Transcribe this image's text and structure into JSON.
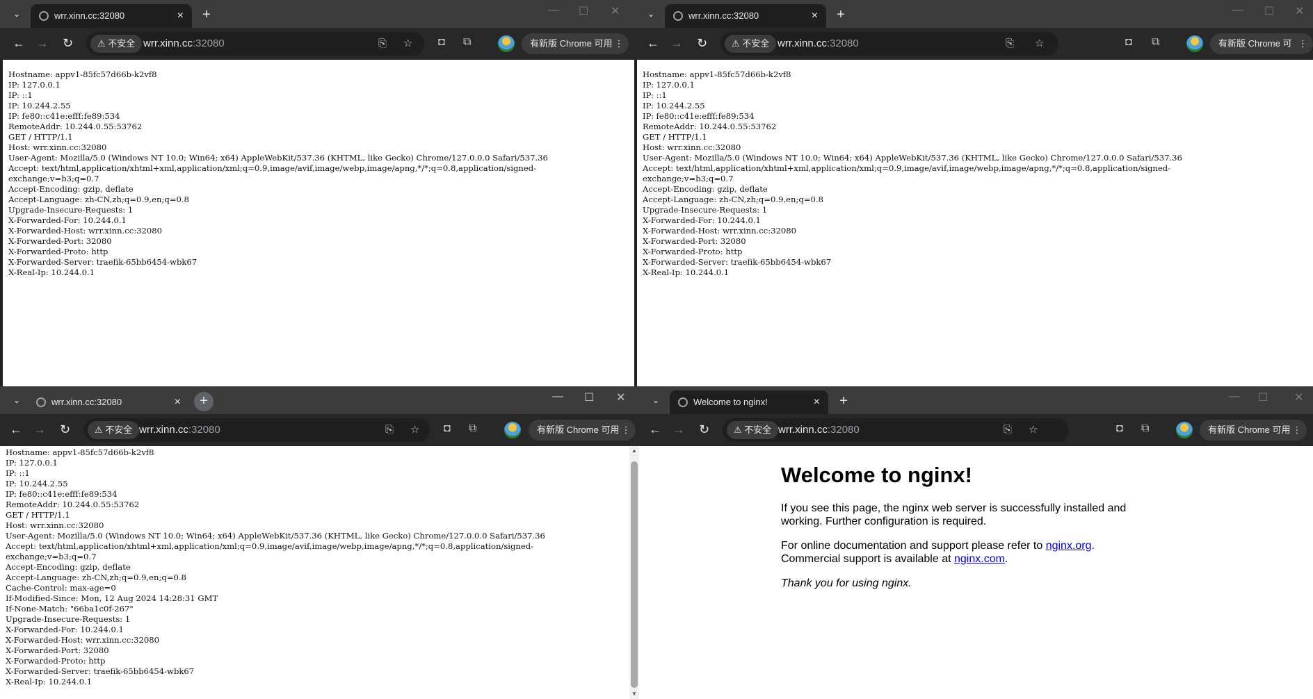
{
  "common": {
    "tab_title": "wrr.xinn.cc:32080",
    "not_secure": "不安全",
    "host": "wrr.xinn.cc",
    "port": ":32080",
    "update_label": "有新版 Chrome 可用",
    "new_tab": "+",
    "tab_close": "×",
    "minimize": "—",
    "maximize": "☐",
    "close": "✕",
    "back": "←",
    "forward": "→",
    "reload": "↻",
    "translate_icon": "⎘",
    "star_icon": "☆",
    "camera_icon": "◘",
    "extensions_icon": "⧉",
    "menu": "⋮",
    "search_tabs": "⌄"
  },
  "window1": {
    "body": "Hostname: appv1-85fc57d66b-k2vf8\nIP: 127.0.0.1\nIP: ::1\nIP: 10.244.2.55\nIP: fe80::c41e:efff:fe89:534\nRemoteAddr: 10.244.0.55:53762\nGET / HTTP/1.1\nHost: wrr.xinn.cc:32080\nUser-Agent: Mozilla/5.0 (Windows NT 10.0; Win64; x64) AppleWebKit/537.36 (KHTML, like Gecko) Chrome/127.0.0.0 Safari/537.36\nAccept: text/html,application/xhtml+xml,application/xml;q=0.9,image/avif,image/webp,image/apng,*/*;q=0.8,application/signed-\nexchange;v=b3;q=0.7\nAccept-Encoding: gzip, deflate\nAccept-Language: zh-CN,zh;q=0.9,en;q=0.8\nUpgrade-Insecure-Requests: 1\nX-Forwarded-For: 10.244.0.1\nX-Forwarded-Host: wrr.xinn.cc:32080\nX-Forwarded-Port: 32080\nX-Forwarded-Proto: http\nX-Forwarded-Server: traefik-65bb6454-wbk67\nX-Real-Ip: 10.244.0.1"
  },
  "window2": {
    "body": "Hostname: appv1-85fc57d66b-k2vf8\nIP: 127.0.0.1\nIP: ::1\nIP: 10.244.2.55\nIP: fe80::c41e:efff:fe89:534\nRemoteAddr: 10.244.0.55:53762\nGET / HTTP/1.1\nHost: wrr.xinn.cc:32080\nUser-Agent: Mozilla/5.0 (Windows NT 10.0; Win64; x64) AppleWebKit/537.36 (KHTML, like Gecko) Chrome/127.0.0.0 Safari/537.36\nAccept: text/html,application/xhtml+xml,application/xml;q=0.9,image/avif,image/webp,image/apng,*/*;q=0.8,application/signed-\nexchange;v=b3;q=0.7\nAccept-Encoding: gzip, deflate\nAccept-Language: zh-CN,zh;q=0.9,en;q=0.8\nUpgrade-Insecure-Requests: 1\nX-Forwarded-For: 10.244.0.1\nX-Forwarded-Host: wrr.xinn.cc:32080\nX-Forwarded-Port: 32080\nX-Forwarded-Proto: http\nX-Forwarded-Server: traefik-65bb6454-wbk67\nX-Real-Ip: 10.244.0.1"
  },
  "window3": {
    "body": "Hostname: appv1-85fc57d66b-k2vf8\nIP: 127.0.0.1\nIP: ::1\nIP: 10.244.2.55\nIP: fe80::c41e:efff:fe89:534\nRemoteAddr: 10.244.0.55:53762\nGET / HTTP/1.1\nHost: wrr.xinn.cc:32080\nUser-Agent: Mozilla/5.0 (Windows NT 10.0; Win64; x64) AppleWebKit/537.36 (KHTML, like Gecko) Chrome/127.0.0.0 Safari/537.36\nAccept: text/html,application/xhtml+xml,application/xml;q=0.9,image/avif,image/webp,image/apng,*/*;q=0.8,application/signed-\nexchange;v=b3;q=0.7\nAccept-Encoding: gzip, deflate\nAccept-Language: zh-CN,zh;q=0.9,en;q=0.8\nCache-Control: max-age=0\nIf-Modified-Since: Mon, 12 Aug 2024 14:28:31 GMT\nIf-None-Match: \"66ba1c0f-267\"\nUpgrade-Insecure-Requests: 1\nX-Forwarded-For: 10.244.0.1\nX-Forwarded-Host: wrr.xinn.cc:32080\nX-Forwarded-Port: 32080\nX-Forwarded-Proto: http\nX-Forwarded-Server: traefik-65bb6454-wbk67\nX-Real-Ip: 10.244.0.1",
    "scroll_up": "▲",
    "scroll_down": "▼"
  },
  "window4": {
    "tab_title": "Welcome to nginx!",
    "heading": "Welcome to nginx!",
    "para1": "If you see this page, the nginx web server is successfully installed and working. Further configuration is required.",
    "para2_prefix": "For online documentation and support please refer to ",
    "link1": "nginx.org",
    "para2_mid": ".",
    "para2_second": "Commercial support is available at ",
    "link2": "nginx.com",
    "para2_end": ".",
    "thanks": "Thank you for using nginx."
  }
}
